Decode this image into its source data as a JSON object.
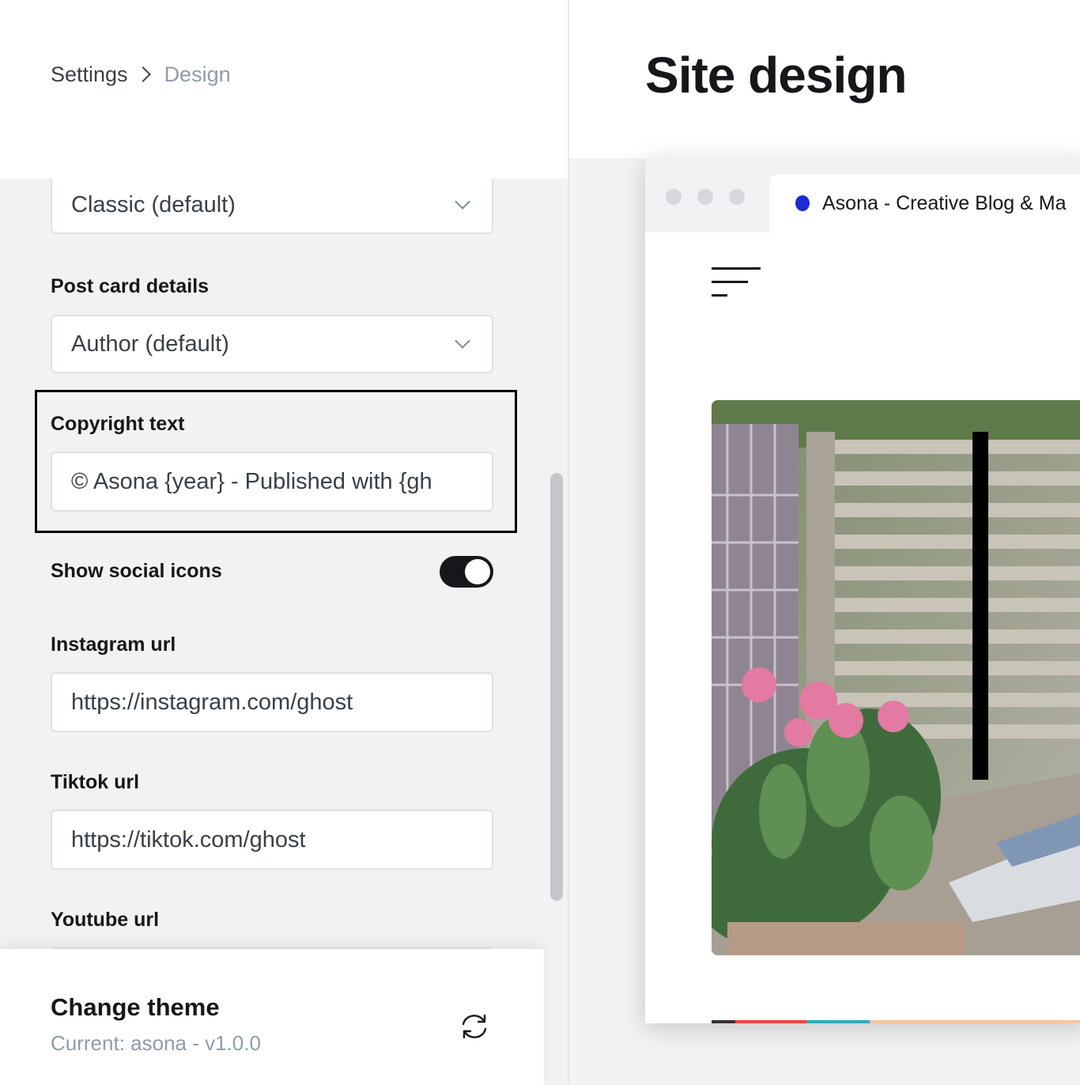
{
  "breadcrumb": {
    "root": "Settings",
    "current": "Design"
  },
  "settings": {
    "feed_layout": {
      "value": "Classic (default)"
    },
    "post_card_details": {
      "label": "Post card details",
      "value": "Author (default)"
    },
    "copyright_text": {
      "label": "Copyright text",
      "value": "© Asona {year} - Published with {gh"
    },
    "show_social_icons": {
      "label": "Show social icons",
      "enabled": true
    },
    "instagram_url": {
      "label": "Instagram url",
      "value": "https://instagram.com/ghost"
    },
    "tiktok_url": {
      "label": "Tiktok url",
      "value": "https://tiktok.com/ghost"
    },
    "youtube_url": {
      "label": "Youtube url"
    }
  },
  "footer": {
    "title": "Change theme",
    "current": "Current: asona - v1.0.0",
    "icon": "refresh-icon"
  },
  "preview": {
    "page_title": "Site design",
    "tab_title": "Asona - Creative Blog & Ma",
    "favicon_color": "#1e2bd6",
    "menu_icon": "hamburger-icon",
    "hero_image": "photo of pink flowers in a pot on an outdoor table with a laptop, wooden fence and plaid cushion behind"
  },
  "colors": {
    "accent_dark": "#15171a",
    "muted_text": "#8e9cac",
    "sidebar_bg": "#f1f2f4",
    "focus_outline": "#000000"
  }
}
